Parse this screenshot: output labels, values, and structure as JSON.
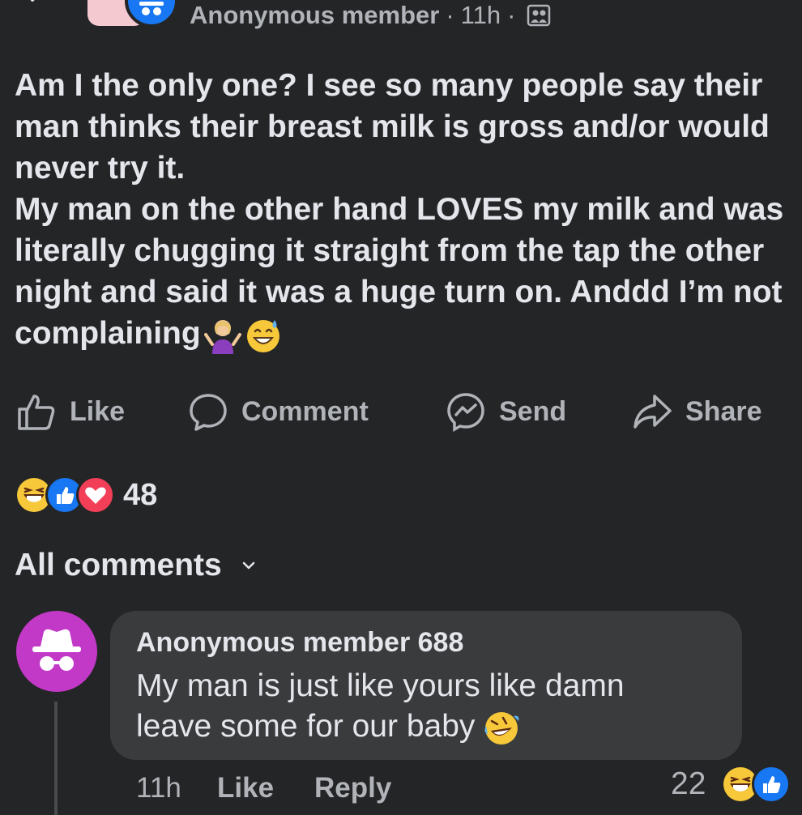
{
  "header": {
    "author": "Anonymous member",
    "separator": "·",
    "time": "11h",
    "visibility_icon": "group-icon"
  },
  "post": {
    "text": "Am I the only one? I see so many people say their man thinks their breast milk is gross and/or would never try it.\nMy man on the other hand LOVES my milk and was literally chugging it straight from the tap the other night and said it was a huge turn on. Anddd I’m not complaining",
    "emojis": [
      "woman-shrugging-emoji",
      "grinning-sweat-emoji"
    ]
  },
  "actions": {
    "like": "Like",
    "comment": "Comment",
    "send": "Send",
    "share": "Share"
  },
  "reactions": {
    "icons": [
      "haha-reaction-icon",
      "like-reaction-icon",
      "love-reaction-icon"
    ],
    "count": "48"
  },
  "comments_header": {
    "label": "All comments"
  },
  "comment": {
    "author": "Anonymous member 688",
    "text": "My man is just like yours like damn\nleave some for our baby",
    "emoji": "rolling-laughing-emoji",
    "time": "11h",
    "like": "Like",
    "reply": "Reply",
    "reaction_count": "22",
    "reaction_icons": [
      "haha-reaction-icon",
      "like-reaction-icon"
    ]
  },
  "colors": {
    "background": "#242526",
    "bubble": "#3a3b3c",
    "text": "#e4e6eb",
    "muted": "#b0b3b8",
    "anon_blue": "#1877f2",
    "anon_purple": "#c238c7"
  }
}
